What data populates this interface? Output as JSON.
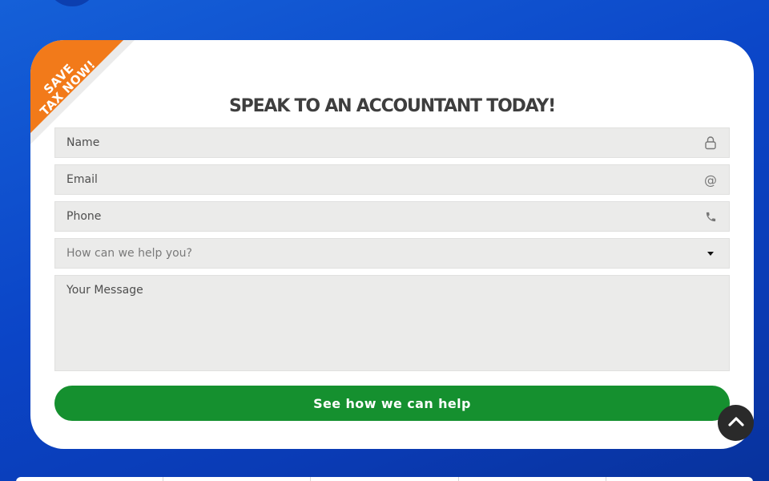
{
  "ribbon": {
    "line1": "SAVE",
    "line2": "TAX NOW!"
  },
  "form": {
    "title": "SPEAK TO AN ACCOUNTANT TODAY!",
    "name_placeholder": "Name",
    "email_placeholder": "Email",
    "phone_placeholder": "Phone",
    "help_placeholder": "How can we help you?",
    "message_placeholder": "Your Message",
    "submit_label": "See how we can help"
  },
  "icons": {
    "name": "user-icon",
    "email": "at-icon",
    "phone": "phone-icon",
    "select": "caret-down-icon",
    "scroll": "chevron-up-icon"
  },
  "colors": {
    "background": "#0b45c7",
    "ribbon": "#f27a1a",
    "submit": "#15902f",
    "field": "#ebebea",
    "title": "#3e3e3e"
  }
}
